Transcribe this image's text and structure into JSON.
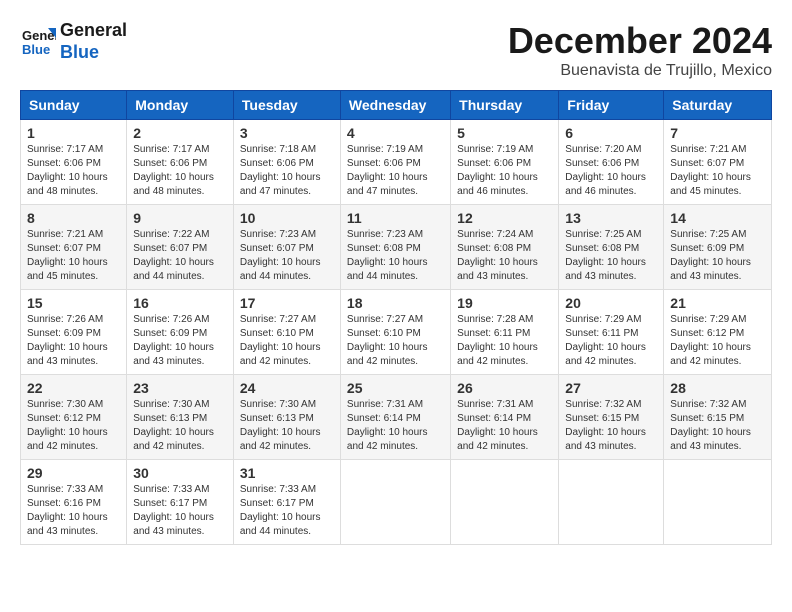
{
  "logo": {
    "line1": "General",
    "line2": "Blue"
  },
  "title": "December 2024",
  "location": "Buenavista de Trujillo, Mexico",
  "days_of_week": [
    "Sunday",
    "Monday",
    "Tuesday",
    "Wednesday",
    "Thursday",
    "Friday",
    "Saturday"
  ],
  "weeks": [
    [
      {
        "day": "1",
        "info": "Sunrise: 7:17 AM\nSunset: 6:06 PM\nDaylight: 10 hours\nand 48 minutes."
      },
      {
        "day": "2",
        "info": "Sunrise: 7:17 AM\nSunset: 6:06 PM\nDaylight: 10 hours\nand 48 minutes."
      },
      {
        "day": "3",
        "info": "Sunrise: 7:18 AM\nSunset: 6:06 PM\nDaylight: 10 hours\nand 47 minutes."
      },
      {
        "day": "4",
        "info": "Sunrise: 7:19 AM\nSunset: 6:06 PM\nDaylight: 10 hours\nand 47 minutes."
      },
      {
        "day": "5",
        "info": "Sunrise: 7:19 AM\nSunset: 6:06 PM\nDaylight: 10 hours\nand 46 minutes."
      },
      {
        "day": "6",
        "info": "Sunrise: 7:20 AM\nSunset: 6:06 PM\nDaylight: 10 hours\nand 46 minutes."
      },
      {
        "day": "7",
        "info": "Sunrise: 7:21 AM\nSunset: 6:07 PM\nDaylight: 10 hours\nand 45 minutes."
      }
    ],
    [
      {
        "day": "8",
        "info": "Sunrise: 7:21 AM\nSunset: 6:07 PM\nDaylight: 10 hours\nand 45 minutes."
      },
      {
        "day": "9",
        "info": "Sunrise: 7:22 AM\nSunset: 6:07 PM\nDaylight: 10 hours\nand 44 minutes."
      },
      {
        "day": "10",
        "info": "Sunrise: 7:23 AM\nSunset: 6:07 PM\nDaylight: 10 hours\nand 44 minutes."
      },
      {
        "day": "11",
        "info": "Sunrise: 7:23 AM\nSunset: 6:08 PM\nDaylight: 10 hours\nand 44 minutes."
      },
      {
        "day": "12",
        "info": "Sunrise: 7:24 AM\nSunset: 6:08 PM\nDaylight: 10 hours\nand 43 minutes."
      },
      {
        "day": "13",
        "info": "Sunrise: 7:25 AM\nSunset: 6:08 PM\nDaylight: 10 hours\nand 43 minutes."
      },
      {
        "day": "14",
        "info": "Sunrise: 7:25 AM\nSunset: 6:09 PM\nDaylight: 10 hours\nand 43 minutes."
      }
    ],
    [
      {
        "day": "15",
        "info": "Sunrise: 7:26 AM\nSunset: 6:09 PM\nDaylight: 10 hours\nand 43 minutes."
      },
      {
        "day": "16",
        "info": "Sunrise: 7:26 AM\nSunset: 6:09 PM\nDaylight: 10 hours\nand 43 minutes."
      },
      {
        "day": "17",
        "info": "Sunrise: 7:27 AM\nSunset: 6:10 PM\nDaylight: 10 hours\nand 42 minutes."
      },
      {
        "day": "18",
        "info": "Sunrise: 7:27 AM\nSunset: 6:10 PM\nDaylight: 10 hours\nand 42 minutes."
      },
      {
        "day": "19",
        "info": "Sunrise: 7:28 AM\nSunset: 6:11 PM\nDaylight: 10 hours\nand 42 minutes."
      },
      {
        "day": "20",
        "info": "Sunrise: 7:29 AM\nSunset: 6:11 PM\nDaylight: 10 hours\nand 42 minutes."
      },
      {
        "day": "21",
        "info": "Sunrise: 7:29 AM\nSunset: 6:12 PM\nDaylight: 10 hours\nand 42 minutes."
      }
    ],
    [
      {
        "day": "22",
        "info": "Sunrise: 7:30 AM\nSunset: 6:12 PM\nDaylight: 10 hours\nand 42 minutes."
      },
      {
        "day": "23",
        "info": "Sunrise: 7:30 AM\nSunset: 6:13 PM\nDaylight: 10 hours\nand 42 minutes."
      },
      {
        "day": "24",
        "info": "Sunrise: 7:30 AM\nSunset: 6:13 PM\nDaylight: 10 hours\nand 42 minutes."
      },
      {
        "day": "25",
        "info": "Sunrise: 7:31 AM\nSunset: 6:14 PM\nDaylight: 10 hours\nand 42 minutes."
      },
      {
        "day": "26",
        "info": "Sunrise: 7:31 AM\nSunset: 6:14 PM\nDaylight: 10 hours\nand 42 minutes."
      },
      {
        "day": "27",
        "info": "Sunrise: 7:32 AM\nSunset: 6:15 PM\nDaylight: 10 hours\nand 43 minutes."
      },
      {
        "day": "28",
        "info": "Sunrise: 7:32 AM\nSunset: 6:15 PM\nDaylight: 10 hours\nand 43 minutes."
      }
    ],
    [
      {
        "day": "29",
        "info": "Sunrise: 7:33 AM\nSunset: 6:16 PM\nDaylight: 10 hours\nand 43 minutes."
      },
      {
        "day": "30",
        "info": "Sunrise: 7:33 AM\nSunset: 6:17 PM\nDaylight: 10 hours\nand 43 minutes."
      },
      {
        "day": "31",
        "info": "Sunrise: 7:33 AM\nSunset: 6:17 PM\nDaylight: 10 hours\nand 44 minutes."
      },
      {
        "day": "",
        "info": ""
      },
      {
        "day": "",
        "info": ""
      },
      {
        "day": "",
        "info": ""
      },
      {
        "day": "",
        "info": ""
      }
    ]
  ]
}
